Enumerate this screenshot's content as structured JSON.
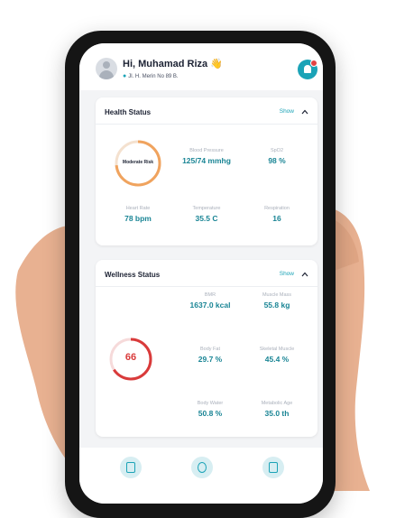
{
  "header": {
    "greeting": "Hi, Muhamad Riza",
    "wave_emoji": "👋",
    "address": "Jl. H. Merin No 89 B."
  },
  "health_status": {
    "title": "Health Status",
    "toggle_label": "Show",
    "risk_label": "Moderate Risk",
    "metrics": [
      {
        "label": "Blood Pressure",
        "value": "125/74 mmhg"
      },
      {
        "label": "SpO2",
        "value": "98 %"
      },
      {
        "label": "Heart Rate",
        "value": "78 bpm"
      },
      {
        "label": "Temperature",
        "value": "35.5 C"
      },
      {
        "label": "Respiration",
        "value": "16"
      }
    ]
  },
  "wellness_status": {
    "title": "Wellness Status",
    "toggle_label": "Show",
    "score": "66",
    "metrics": [
      {
        "label": "BMR",
        "value": "1637.0 kcal"
      },
      {
        "label": "Muscle Mass",
        "value": "55.8 kg"
      },
      {
        "label": "Body Fat",
        "value": "29.7 %"
      },
      {
        "label": "Skeletal Muscle",
        "value": "45.4 %"
      },
      {
        "label": "Body Water",
        "value": "50.8 %"
      },
      {
        "label": "Metabolic Age",
        "value": "35.0 th"
      }
    ]
  },
  "nav": {
    "items": [
      {
        "icon": "report-icon"
      },
      {
        "icon": "doctor-icon"
      },
      {
        "icon": "file-icon"
      }
    ]
  },
  "colors": {
    "accent": "#1ba3b7",
    "value_text": "#1a8595",
    "ring_orange": "#f0a35e",
    "ring_red": "#d93a3a",
    "skin": "#e8b191"
  }
}
